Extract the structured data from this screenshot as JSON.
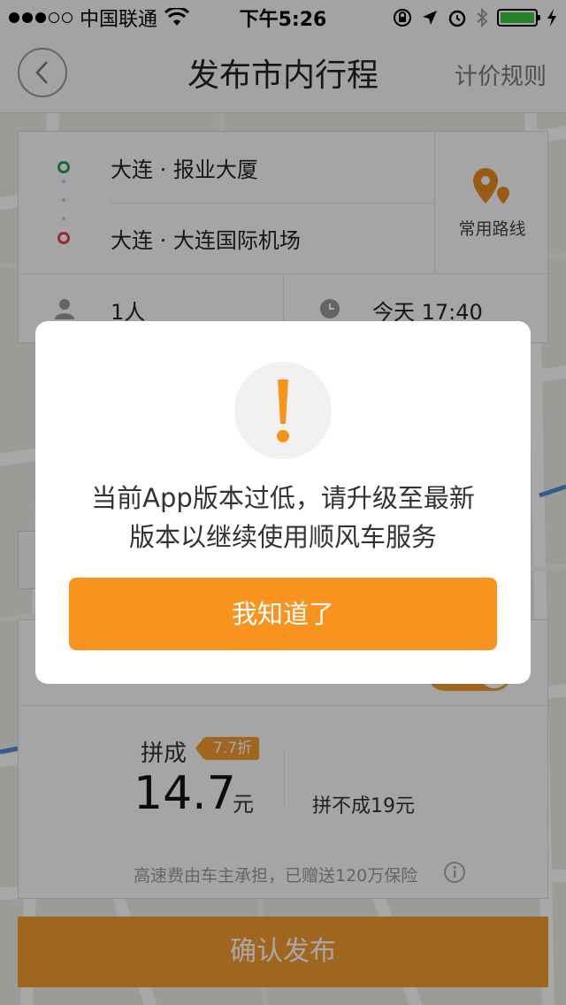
{
  "status_bar": {
    "carrier": "中国联通",
    "time": "下午5:26",
    "signal_dots_on": 3,
    "signal_dots_total": 5,
    "battery_level": 1.0
  },
  "nav": {
    "back_icon": "chevron-left-icon",
    "title": "发布市内行程",
    "pricing_rules": "计价规则"
  },
  "trip": {
    "origin": "大连 · 报业大厦",
    "destination": "大连 · 大连国际机场",
    "common_routes_label": "常用路线",
    "passengers": "1人",
    "time": "今天 17:40"
  },
  "price": {
    "carpool_label": "拼成",
    "discount": "7.7折",
    "carpool_price": "14.7",
    "unit": "元",
    "no_carpool": "拼不成19元",
    "insurance_note": "高速费由车主承担，已赠送120万保险"
  },
  "confirm_label": "确认发布",
  "modal": {
    "icon": "exclamation-icon",
    "message_line1": "当前App版本过低，请升级至最新",
    "message_line2": "版本以继续使用顺风车服务",
    "ok_label": "我知道了"
  },
  "colors": {
    "accent": "#f7931e",
    "origin_dot": "#2a9d5c",
    "destination_dot": "#e0414f"
  }
}
